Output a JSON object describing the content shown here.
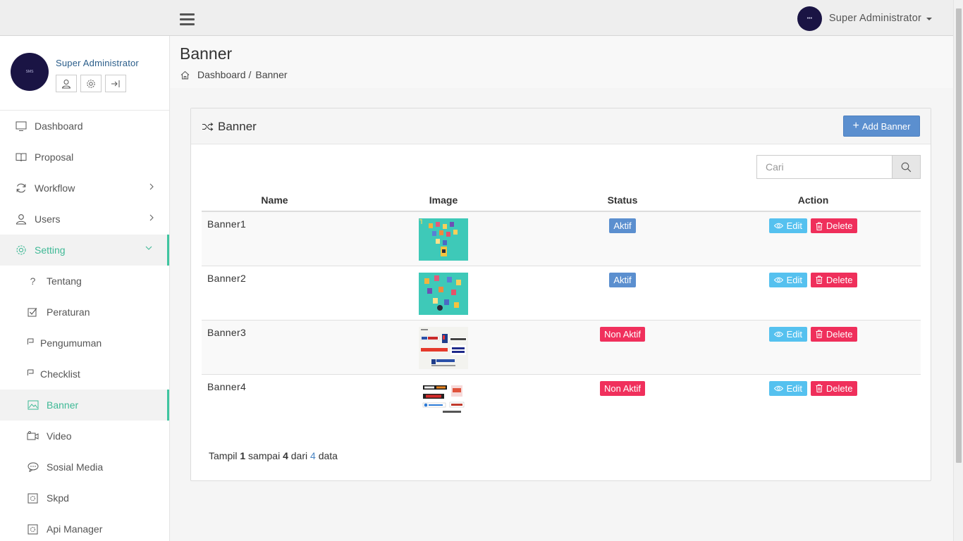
{
  "topbar": {
    "user_name": "Super Administrator",
    "avatar_text": "•••"
  },
  "sidebar": {
    "profile_name": "Super Administrator",
    "profile_avatar_text": "SMS",
    "items": [
      {
        "label": "Dashboard",
        "icon": "monitor-icon"
      },
      {
        "label": "Proposal",
        "icon": "book-icon"
      },
      {
        "label": "Workflow",
        "icon": "refresh-icon"
      },
      {
        "label": "Users",
        "icon": "user-icon"
      },
      {
        "label": "Setting",
        "icon": "gear-icon"
      }
    ],
    "sub_items": [
      {
        "label": "Tentang",
        "icon": "question-icon"
      },
      {
        "label": "Peraturan",
        "icon": "checkbox-icon"
      },
      {
        "label": "Pengumuman",
        "icon": "flag-icon"
      },
      {
        "label": "Checklist",
        "icon": "flag-icon"
      },
      {
        "label": "Banner",
        "icon": "image-icon"
      },
      {
        "label": "Video",
        "icon": "video-icon"
      },
      {
        "label": "Sosial Media",
        "icon": "chat-icon"
      },
      {
        "label": "Skpd",
        "icon": "target-icon"
      },
      {
        "label": "Api Manager",
        "icon": "target-icon"
      }
    ]
  },
  "page": {
    "title": "Banner",
    "breadcrumb": {
      "home": "Dashboard",
      "separator": "/",
      "current": "Banner"
    }
  },
  "panel": {
    "title": "Banner",
    "add_label": "Add Banner",
    "search_placeholder": "Cari"
  },
  "table": {
    "headers": [
      "Name",
      "Image",
      "Status",
      "Action"
    ],
    "rows": [
      {
        "name": "Banner1",
        "status": "Aktif",
        "status_type": "on"
      },
      {
        "name": "Banner2",
        "status": "Aktif",
        "status_type": "on"
      },
      {
        "name": "Banner3",
        "status": "Non Aktif",
        "status_type": "off"
      },
      {
        "name": "Banner4",
        "status": "Non Aktif",
        "status_type": "off"
      }
    ],
    "edit_label": "Edit",
    "delete_label": "Delete"
  },
  "footer": {
    "prefix": "Tampil",
    "from": "1",
    "mid": "sampai",
    "to": "4",
    "of": "dari",
    "total": "4",
    "suffix": "data"
  },
  "colors": {
    "accent": "#3fc5a0",
    "primary": "#5b8fcf",
    "danger": "#ef2f5b",
    "info": "#55c1ef"
  }
}
